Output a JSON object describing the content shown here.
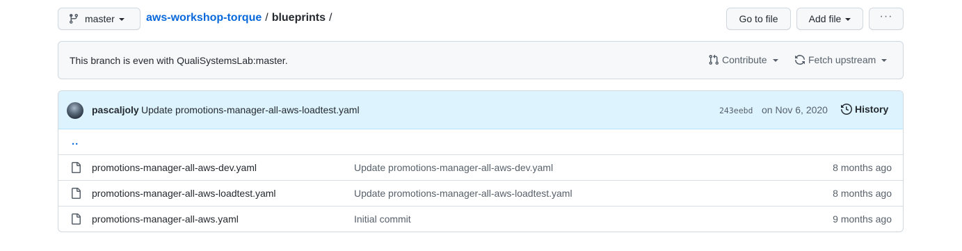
{
  "branch": {
    "name": "master",
    "icon": "git-branch-icon"
  },
  "breadcrumb": {
    "repo": "aws-workshop-torque",
    "separator": "/",
    "dir": "blueprints",
    "trailing": "/"
  },
  "actions": {
    "goto_file": "Go to file",
    "add_file": "Add file",
    "more": "···"
  },
  "branch_status": {
    "message": "This branch is even with QualiSystemsLab:master.",
    "contribute": "Contribute",
    "fetch_upstream": "Fetch upstream"
  },
  "latest_commit": {
    "author": "pascaljoly",
    "message": "Update promotions-manager-all-aws-loadtest.yaml",
    "sha": "243eebd",
    "date": "on Nov 6, 2020",
    "history": "History"
  },
  "parent_dir": "..",
  "files": [
    {
      "name": "promotions-manager-all-aws-dev.yaml",
      "message": "Update promotions-manager-all-aws-dev.yaml",
      "age": "8 months ago"
    },
    {
      "name": "promotions-manager-all-aws-loadtest.yaml",
      "message": "Update promotions-manager-all-aws-loadtest.yaml",
      "age": "8 months ago"
    },
    {
      "name": "promotions-manager-all-aws.yaml",
      "message": "Initial commit",
      "age": "9 months ago"
    }
  ],
  "colors": {
    "link": "#0969da",
    "commit_bar": "#ddf4ff",
    "border": "#d0d7de"
  }
}
